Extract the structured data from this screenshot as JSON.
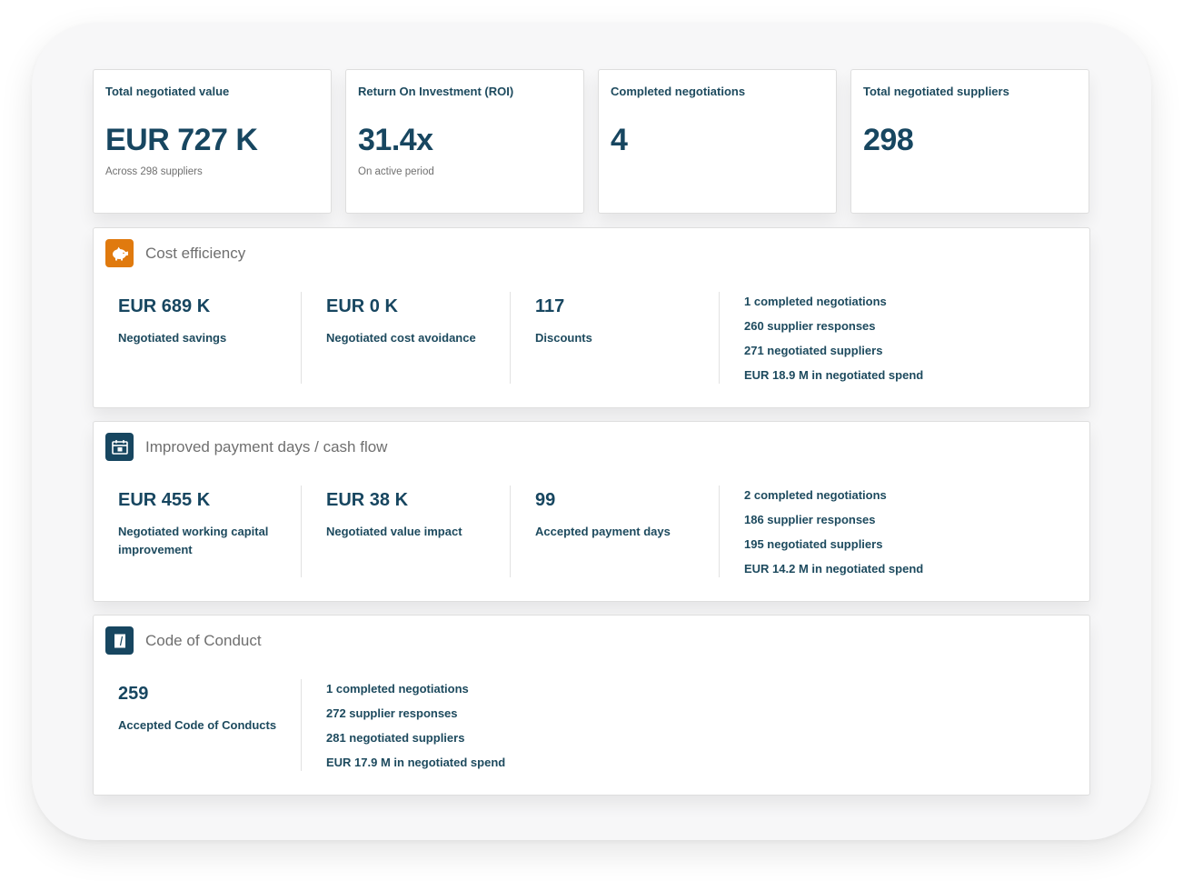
{
  "kpis": [
    {
      "title": "Total negotiated value",
      "value": "EUR 727 K",
      "sub": "Across 298 suppliers"
    },
    {
      "title": "Return On Investment (ROI)",
      "value": "31.4x",
      "sub": "On active period"
    },
    {
      "title": "Completed negotiations",
      "value": "4",
      "sub": ""
    },
    {
      "title": "Total negotiated suppliers",
      "value": "298",
      "sub": ""
    }
  ],
  "cost_efficiency": {
    "title": "Cost efficiency",
    "icon": "piggy-bank-icon",
    "icon_color": "#e07a0e",
    "metrics": [
      {
        "value": "EUR 689 K",
        "label": "Negotiated savings"
      },
      {
        "value": "EUR 0 K",
        "label": "Negotiated cost avoidance"
      },
      {
        "value": "117",
        "label": "Discounts"
      }
    ],
    "stats": [
      "1 completed negotiations",
      "260 supplier responses",
      "271 negotiated suppliers",
      "EUR 18.9 M in negotiated spend"
    ]
  },
  "payment_days": {
    "title": "Improved payment days / cash flow",
    "icon": "calendar-icon",
    "icon_color": "#174660",
    "metrics": [
      {
        "value": "EUR 455 K",
        "label": "Negotiated working capital improvement"
      },
      {
        "value": "EUR 38 K",
        "label": "Negotiated value impact"
      },
      {
        "value": "99",
        "label": "Accepted payment days"
      }
    ],
    "stats": [
      "2 completed negotiations",
      "186 supplier responses",
      "195 negotiated suppliers",
      "EUR 14.2 M in negotiated spend"
    ]
  },
  "code_of_conduct": {
    "title": "Code of Conduct",
    "icon": "document-icon",
    "icon_color": "#174660",
    "metrics": [
      {
        "value": "259",
        "label": "Accepted Code of Conducts"
      }
    ],
    "stats": [
      "1 completed negotiations",
      "272 supplier responses",
      "281 negotiated suppliers",
      "EUR 17.9 M in negotiated spend"
    ]
  }
}
